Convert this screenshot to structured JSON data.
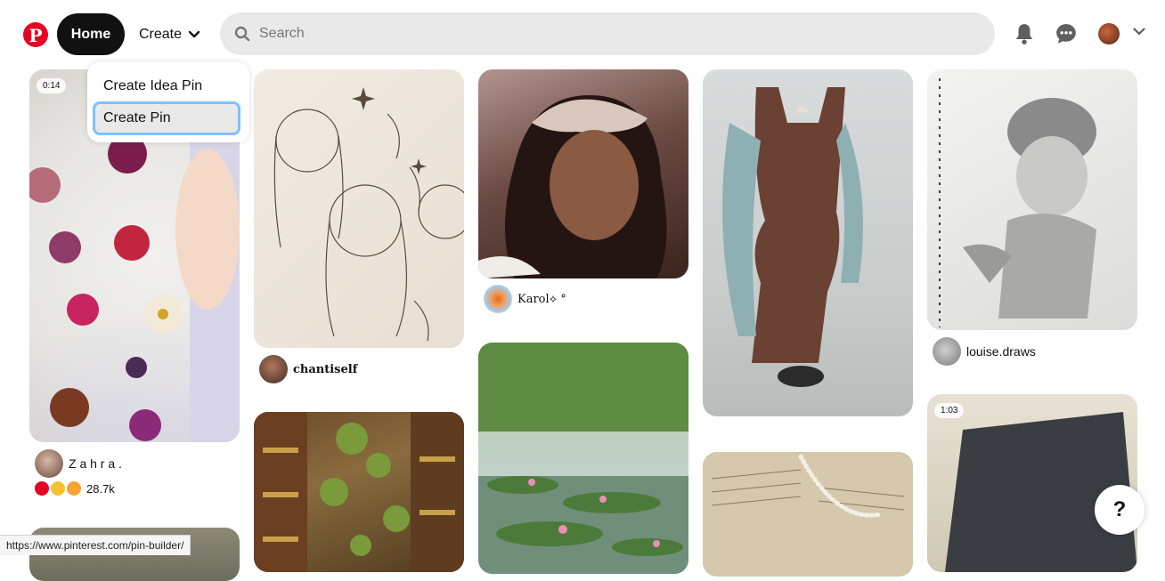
{
  "header": {
    "logo_letter": "P",
    "home_label": "Home",
    "create_label": "Create",
    "search_placeholder": "Search"
  },
  "dropdown": {
    "items": [
      {
        "label": "Create Idea Pin"
      },
      {
        "label": "Create Pin"
      }
    ]
  },
  "pins": [
    {
      "badge": "0:14",
      "author": "Z a h r a .",
      "reaction_count": "28.7k"
    },
    {
      "author": "chantiself"
    },
    {
      "author": "Karol⟡ °"
    },
    {},
    {
      "author": "louise.draws"
    },
    {},
    {},
    {},
    {
      "badge": "1:03"
    }
  ],
  "help_label": "?",
  "status_url": "https://www.pinterest.com/pin-builder/",
  "colors": {
    "brand_red": "#e60023",
    "home_bg": "#111111",
    "search_bg": "#e9e9e9",
    "focus_ring": "#7fc1ff"
  },
  "icons": {
    "logo": "pinterest-logo",
    "search": "search-icon",
    "bell": "bell-icon",
    "chat": "chat-icon",
    "chevron": "chevron-down-icon"
  }
}
